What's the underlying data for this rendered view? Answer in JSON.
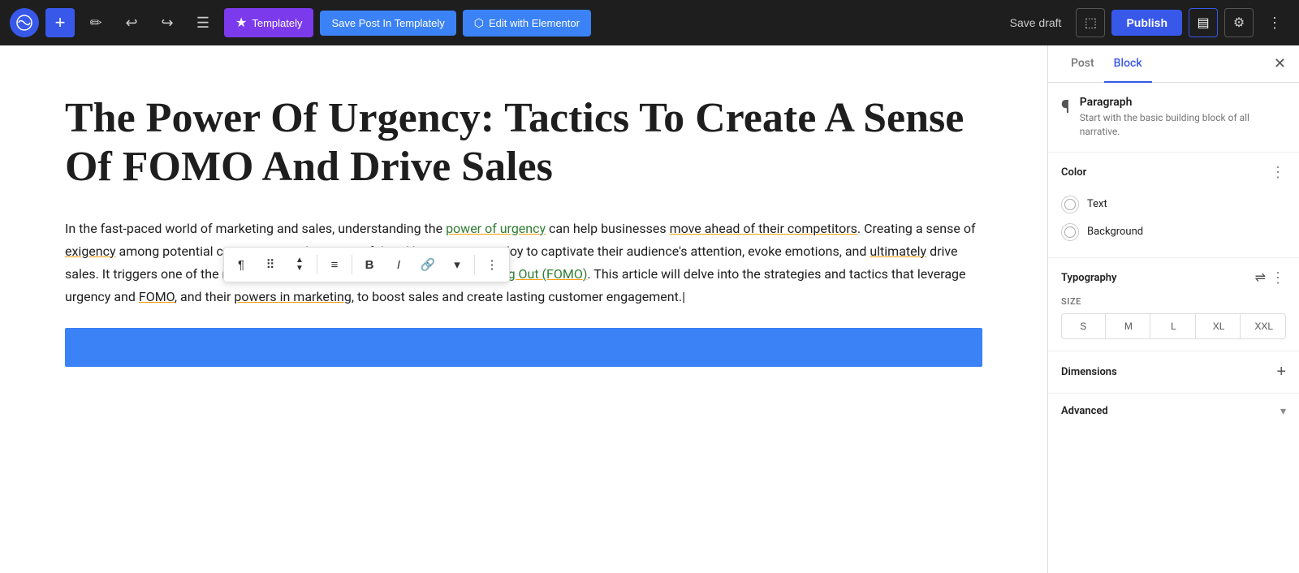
{
  "toolbar": {
    "wp_logo": "W",
    "add_label": "+",
    "pen_icon": "✏",
    "undo_icon": "↩",
    "redo_icon": "↪",
    "list_icon": "☰",
    "templately_label": "Templately",
    "save_templately_label": "Save Post In Templately",
    "elementor_label": "Edit with Elementor",
    "save_draft_label": "Save draft",
    "publish_label": "Publish",
    "view_icon": "⬜",
    "settings_icon": "⚙",
    "dots_icon": "⋮"
  },
  "post": {
    "title": "The Power Of Urgency: Tactics To Create A Sense Of FOMO And Drive Sales",
    "body_html": true
  },
  "inline_toolbar": {
    "para_icon": "¶",
    "drag_icon": "⠿",
    "move_icon": "⌄",
    "align_icon": "≡",
    "bold_icon": "B",
    "italic_icon": "I",
    "link_icon": "🔗",
    "dropdown_icon": "▾",
    "more_icon": "⋮"
  },
  "sidebar": {
    "tab_post": "Post",
    "tab_block": "Block",
    "close_icon": "✕",
    "block": {
      "icon": "¶",
      "label": "Paragraph",
      "description": "Start with the basic building block of all narrative."
    },
    "color_section": {
      "title": "Color",
      "text_label": "Text",
      "background_label": "Background"
    },
    "typography_section": {
      "title": "Typography",
      "size_label": "SIZE",
      "sizes": [
        "S",
        "M",
        "L",
        "XL",
        "XXL"
      ]
    },
    "dimensions_section": {
      "title": "Dimensions"
    },
    "advanced_section": {
      "title": "Advanced"
    }
  }
}
